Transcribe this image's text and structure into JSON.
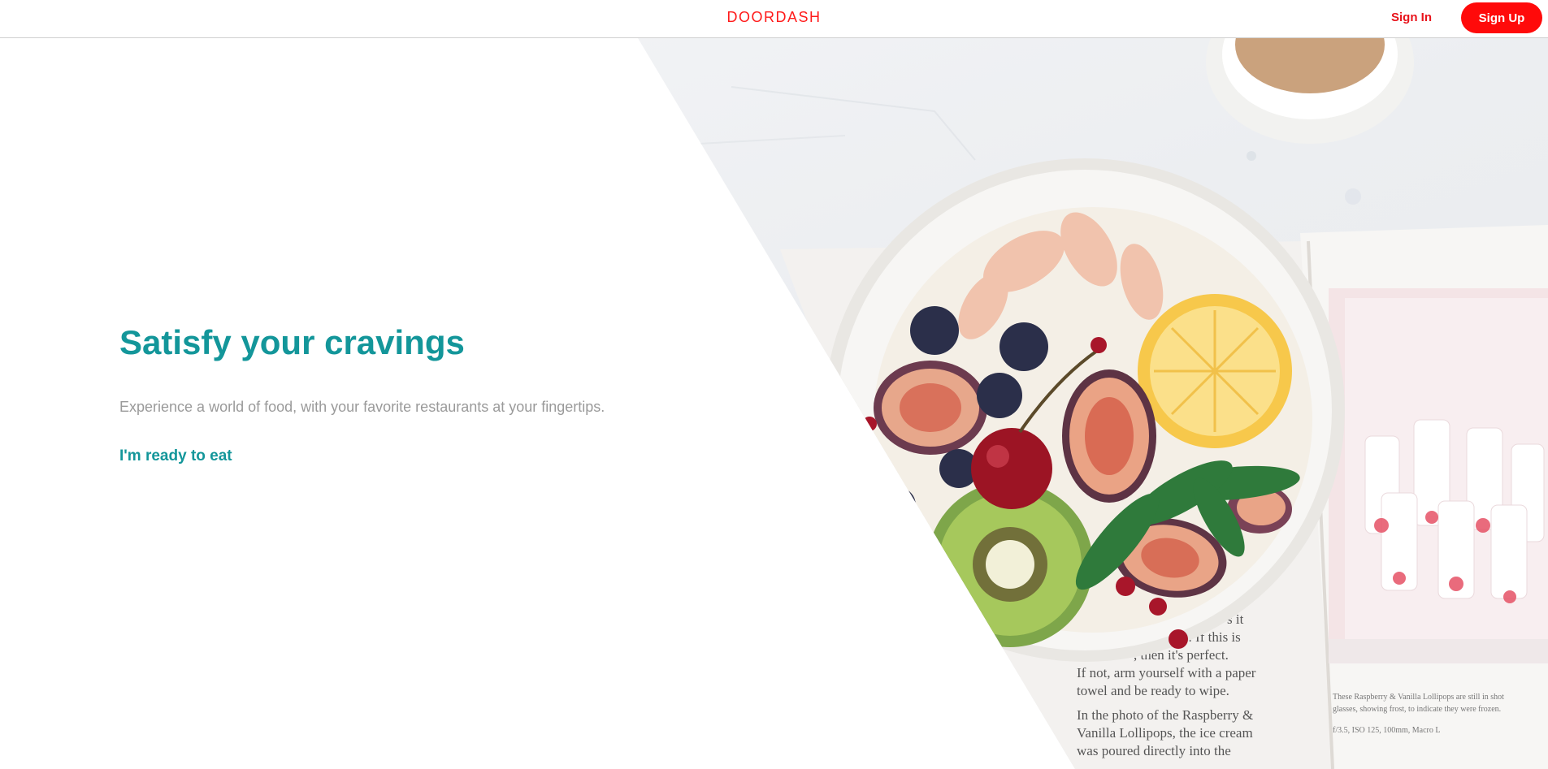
{
  "header": {
    "logo": "DOORDASH",
    "sign_in_label": "Sign In",
    "sign_up_label": "Sign Up"
  },
  "hero": {
    "headline": "Satisfy your cravings",
    "subtext": "Experience a world of food, with your favorite restaurants at your fingertips.",
    "cta_label": "I'm ready to eat"
  },
  "photo": {
    "book_text_lines": [
      "s it",
      "e. If this is",
      ", then it's perfect.",
      "If not, arm yourself with a paper",
      "towel and be ready to wipe.",
      "In the photo of the Raspberry &",
      "Vanilla Lollipops, the ice cream",
      "was poured directly into the"
    ],
    "caption_lines": [
      "These Raspberry & Vanilla Lollipops are still in shot",
      "glasses, showing frost, to indicate they were frozen.",
      "f/3.5, ISO 125, 100mm, Macro L"
    ]
  },
  "colors": {
    "brand_red": "#ff1a1a",
    "teal": "#13969a",
    "muted_text": "#9a9a9a"
  }
}
